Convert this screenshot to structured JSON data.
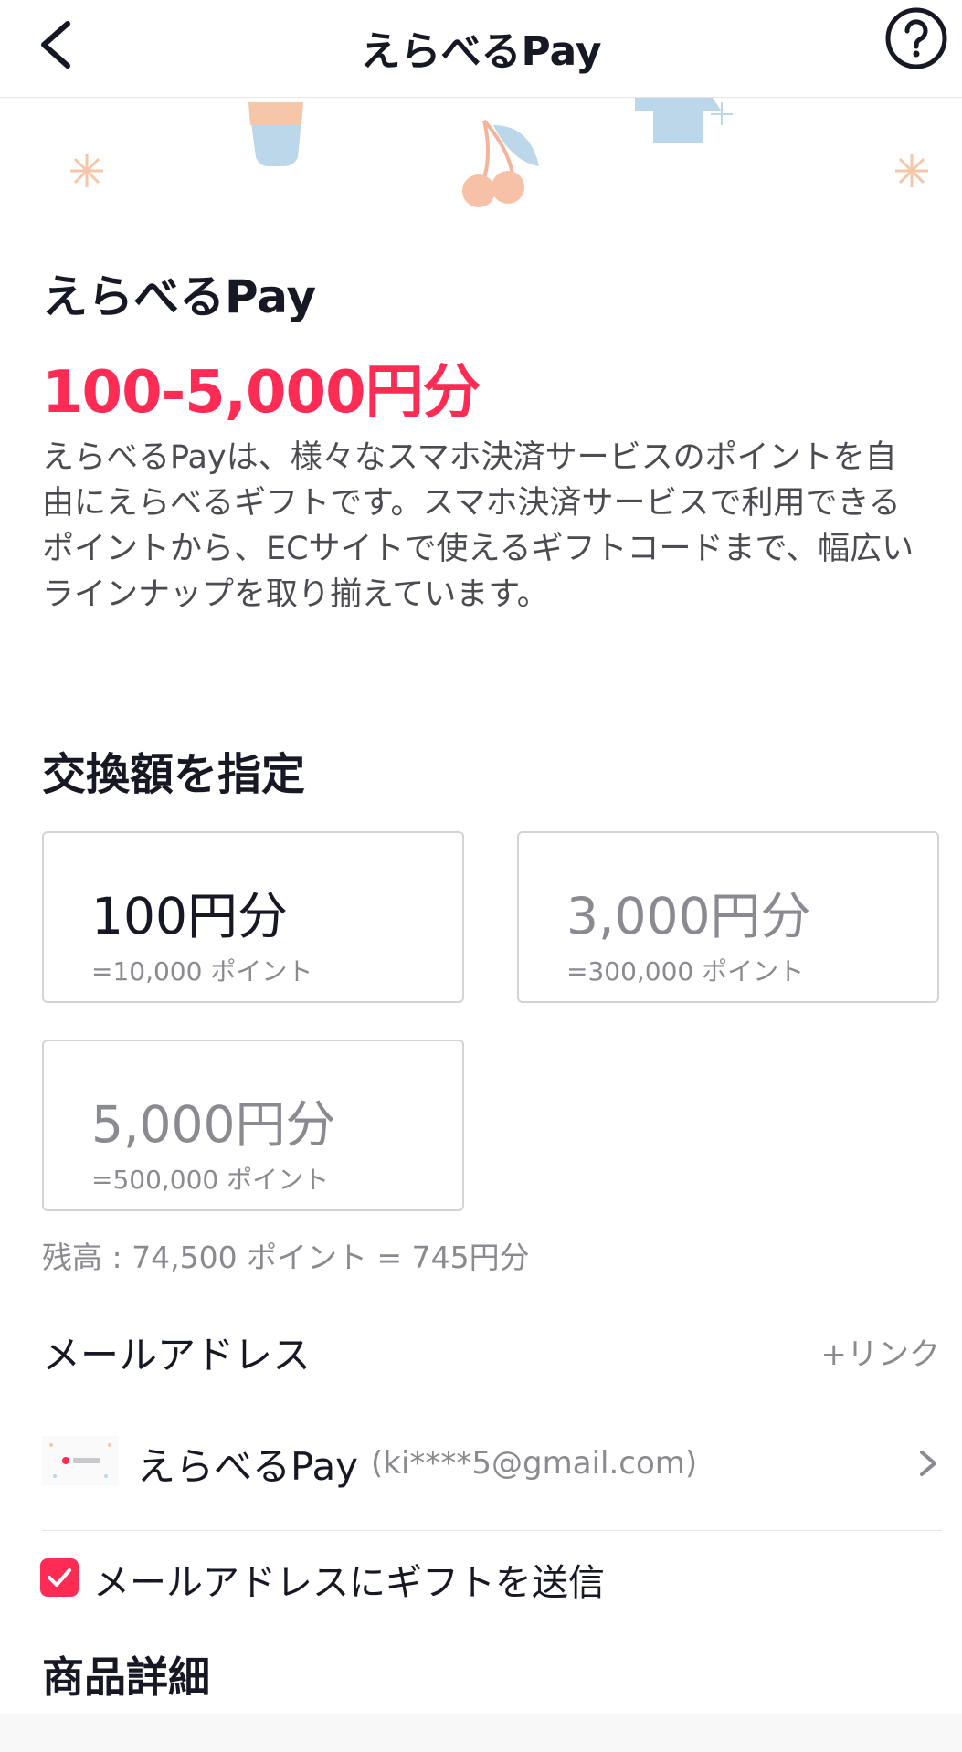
{
  "header": {
    "title": "えらべるPay",
    "back_icon": "chevron-left-icon",
    "help_icon": "question-circle-icon"
  },
  "product": {
    "name": "えらべるPay",
    "price_range": "100-5,000円分",
    "description": "えらべるPayは、様々なスマホ決済サービスのポイントを自由にえらべるギフトです。スマホ決済サービスで利用できるポイントから、ECサイトで使えるギフトコードまで、幅広いラインナップを取り揃えています。"
  },
  "amount_section": {
    "title": "交換額を指定",
    "options": [
      {
        "value": "100円分",
        "points": "=10,000 ポイント",
        "state": "selected"
      },
      {
        "value": "3,000円分",
        "points": "=300,000 ポイント",
        "state": "disabled"
      },
      {
        "value": "5,000円分",
        "points": "=500,000 ポイント",
        "state": "disabled"
      }
    ],
    "balance": "残高 : 74,500 ポイント = 745円分"
  },
  "email_section": {
    "label": "メールアドレス",
    "link_label": "+リンク",
    "account": {
      "name": "えらべるPay",
      "email": "(ki****5@gmail.com)"
    },
    "send_checkbox": {
      "label": "メールアドレスにギフトを送信",
      "checked": true
    }
  },
  "details": {
    "title": "商品詳細"
  },
  "colors": {
    "accent": "#fe2c55",
    "text": "#161823",
    "muted": "#8a8b91",
    "border": "#d3d4d6"
  }
}
